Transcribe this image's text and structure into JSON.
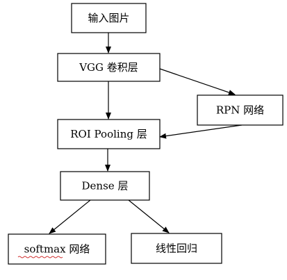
{
  "nodes": {
    "input_image": "输入图片",
    "vgg": "VGG 卷积层",
    "rpn": "RPN 网络",
    "roi": "ROI Pooling 层",
    "dense": "Dense 层",
    "softmax": "softmax 网络",
    "regression": "线性回归"
  },
  "edges": [
    {
      "from": "input_image",
      "to": "vgg"
    },
    {
      "from": "vgg",
      "to": "roi"
    },
    {
      "from": "vgg",
      "to": "rpn"
    },
    {
      "from": "rpn",
      "to": "roi"
    },
    {
      "from": "roi",
      "to": "dense"
    },
    {
      "from": "dense",
      "to": "softmax"
    },
    {
      "from": "dense",
      "to": "regression"
    }
  ],
  "colors": {
    "stroke": "#000000",
    "spellcheck_underline": "#d03030"
  }
}
